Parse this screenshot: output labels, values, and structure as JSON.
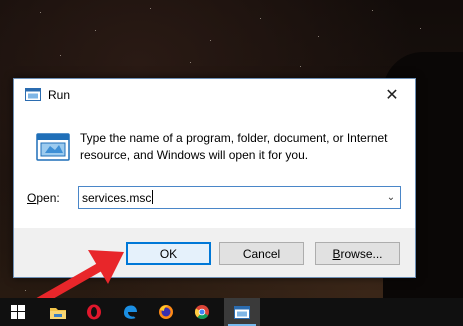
{
  "dialog": {
    "title": "Run",
    "description": "Type the name of a program, folder, document, or Internet resource, and Windows will open it for you.",
    "open_label_prefix": "O",
    "open_label_rest": "pen:",
    "open_value": "services.msc",
    "close_glyph": "✕",
    "dropdown_glyph": "⌄",
    "buttons": {
      "ok": "OK",
      "cancel": "Cancel",
      "browse_prefix": "B",
      "browse_rest": "rowse..."
    }
  },
  "annotation": {
    "arrow_color": "#e8262a"
  },
  "taskbar": {
    "items": [
      {
        "name": "start-button",
        "icon": "windows-logo-icon"
      },
      {
        "name": "file-explorer",
        "icon": "folder-icon"
      },
      {
        "name": "opera",
        "icon": "opera-icon"
      },
      {
        "name": "edge",
        "icon": "edge-icon"
      },
      {
        "name": "firefox",
        "icon": "firefox-icon"
      },
      {
        "name": "chrome",
        "icon": "chrome-icon"
      },
      {
        "name": "run-dialog",
        "icon": "run-icon",
        "active": true
      }
    ]
  },
  "colors": {
    "accent": "#0078d7",
    "taskbar": "#101010"
  }
}
